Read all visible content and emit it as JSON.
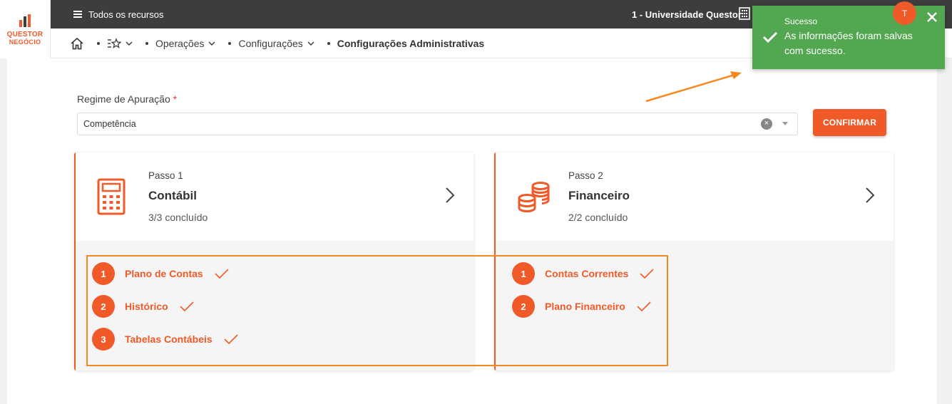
{
  "logo": {
    "line1": "QUESTOR",
    "line2": "NEGÓCIO"
  },
  "topbar": {
    "menu_label": "Todos os recursos",
    "organization": "1 - Universidade Questor",
    "avatar_initial": "T"
  },
  "breadcrumb": {
    "items": [
      "Operações",
      "Configurações"
    ],
    "current": "Configurações Administrativas"
  },
  "form": {
    "label": "Regime de Apuração",
    "required_mark": "*",
    "value": "Competência",
    "confirm_label": "CONFIRMAR"
  },
  "steps": [
    {
      "passo": "Passo 1",
      "title": "Contábil",
      "status": "3/3 concluído",
      "icon": "calculator-icon",
      "items": [
        {
          "num": "1",
          "label": "Plano de Contas"
        },
        {
          "num": "2",
          "label": "Histórico"
        },
        {
          "num": "3",
          "label": "Tabelas Contábeis"
        }
      ]
    },
    {
      "passo": "Passo 2",
      "title": "Financeiro",
      "status": "2/2 concluído",
      "icon": "coins-icon",
      "items": [
        {
          "num": "1",
          "label": "Contas Correntes"
        },
        {
          "num": "2",
          "label": "Plano Financeiro"
        }
      ]
    }
  ],
  "toast": {
    "title": "Sucesso",
    "message": "As informações foram salvas com sucesso.",
    "color": "#53a751"
  },
  "colors": {
    "accent": "#f05a28",
    "topbar": "#3d3d3f",
    "annotation": "#f5891f"
  }
}
